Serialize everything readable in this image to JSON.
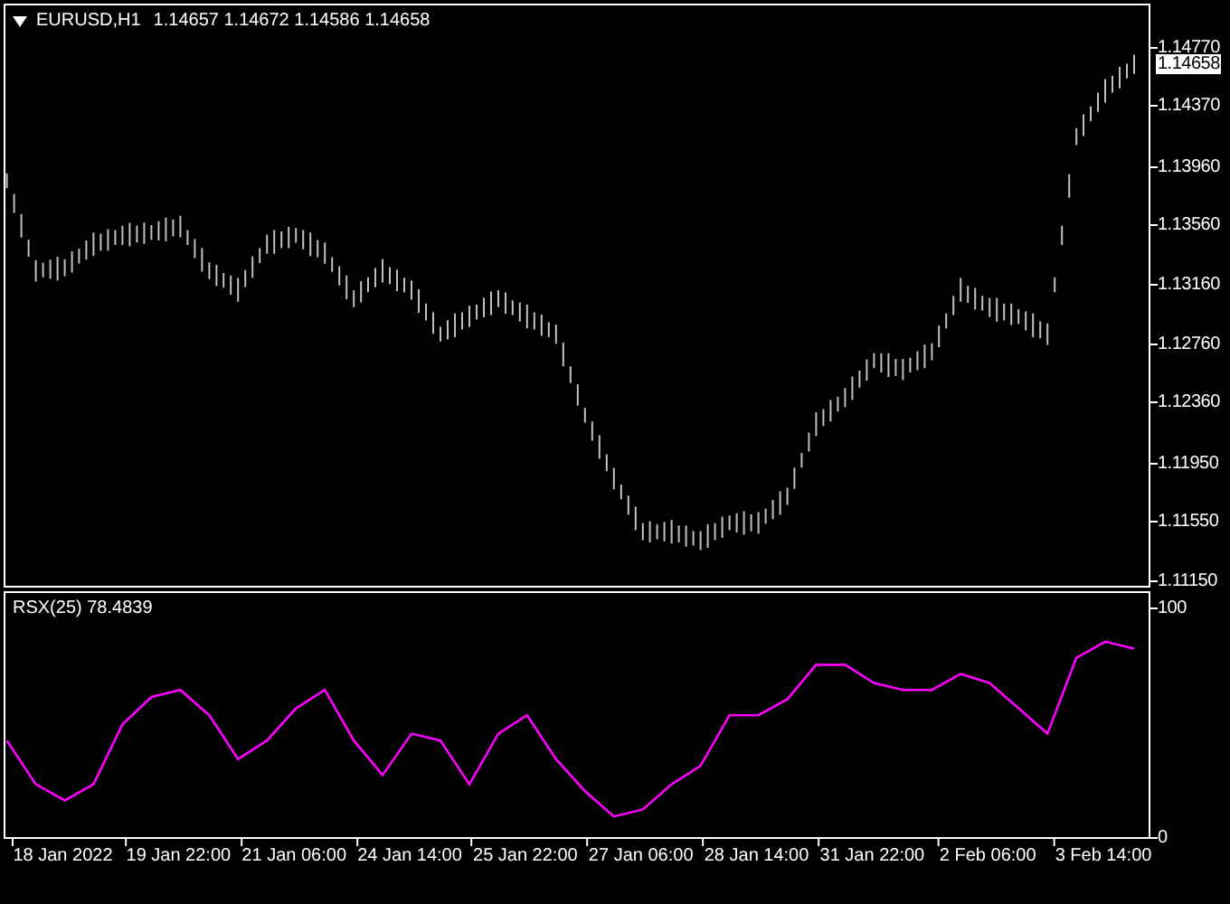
{
  "price_panel": {
    "title": "EURUSD,H1",
    "ohlc": [
      "1.14657",
      "1.14672",
      "1.14586",
      "1.14658"
    ],
    "current_price": "1.14658",
    "axis_labels": [
      "1.14770",
      "1.14370",
      "1.13960",
      "1.13560",
      "1.13160",
      "1.12760",
      "1.12360",
      "1.11950",
      "1.11550",
      "1.11150"
    ]
  },
  "indicator_panel": {
    "chart_data": {
      "type": "line",
      "title": "RSX(25) 78.4839",
      "ylim": [
        0,
        106.2
      ],
      "categories": [
        null,
        null,
        "18 Jan 2022",
        null,
        null,
        null,
        "19 Jan 22:00",
        null,
        null,
        null,
        "21 Jan 06:00",
        null,
        null,
        null,
        "24 Jan 14:00",
        null,
        null,
        null,
        "25 Jan 22:00",
        null,
        null,
        null,
        "27 Jan 06:00",
        null,
        null,
        null,
        "28 Jan 14:00",
        null,
        null,
        null,
        "31 Jan 22:00",
        null,
        null,
        null,
        "2 Feb 06:00",
        null,
        null,
        null,
        "3 Feb 14:00",
        null
      ],
      "yticks": [
        100,
        0
      ],
      "series": [
        {
          "color": "#ff00ff",
          "values": [
            42,
            23,
            16,
            23,
            49,
            61,
            64,
            53,
            34,
            42,
            56,
            64,
            42,
            27,
            45,
            42,
            23,
            45,
            53,
            34,
            20,
            9,
            12,
            23,
            31,
            53,
            53,
            60,
            75,
            75,
            67,
            64,
            64,
            71,
            67,
            56,
            45,
            78,
            85,
            82
          ]
        }
      ]
    }
  }
}
